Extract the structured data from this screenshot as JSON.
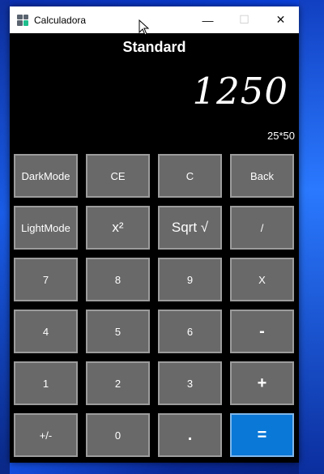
{
  "window": {
    "title": "Calculadora",
    "icon": "calculator-icon",
    "controls": {
      "minimize": "—",
      "maximize": "☐",
      "close": "✕"
    }
  },
  "calculator": {
    "mode": "Standard",
    "display": "1250",
    "expression": "25*50"
  },
  "keys": [
    {
      "name": "darkmode-button",
      "label": "DarkMode"
    },
    {
      "name": "clear-entry-button",
      "label": "CE"
    },
    {
      "name": "clear-button",
      "label": "C"
    },
    {
      "name": "back-button",
      "label": "Back"
    },
    {
      "name": "lightmode-button",
      "label": "LightMode"
    },
    {
      "name": "square-button",
      "label": "x²"
    },
    {
      "name": "sqrt-button",
      "label": "Sqrt √"
    },
    {
      "name": "divide-button",
      "label": "/"
    },
    {
      "name": "digit-7-button",
      "label": "7"
    },
    {
      "name": "digit-8-button",
      "label": "8"
    },
    {
      "name": "digit-9-button",
      "label": "9"
    },
    {
      "name": "multiply-button",
      "label": "X"
    },
    {
      "name": "digit-4-button",
      "label": "4"
    },
    {
      "name": "digit-5-button",
      "label": "5"
    },
    {
      "name": "digit-6-button",
      "label": "6"
    },
    {
      "name": "subtract-button",
      "label": "-"
    },
    {
      "name": "digit-1-button",
      "label": "1"
    },
    {
      "name": "digit-2-button",
      "label": "2"
    },
    {
      "name": "digit-3-button",
      "label": "3"
    },
    {
      "name": "add-button",
      "label": "+"
    },
    {
      "name": "negate-button",
      "label": "+/-"
    },
    {
      "name": "digit-0-button",
      "label": "0"
    },
    {
      "name": "decimal-button",
      "label": "."
    },
    {
      "name": "equals-button",
      "label": "="
    }
  ],
  "colors": {
    "key_bg": "#696969",
    "key_border": "#9c9c9c",
    "equals_bg": "#0a78d7",
    "app_bg": "#000000"
  }
}
